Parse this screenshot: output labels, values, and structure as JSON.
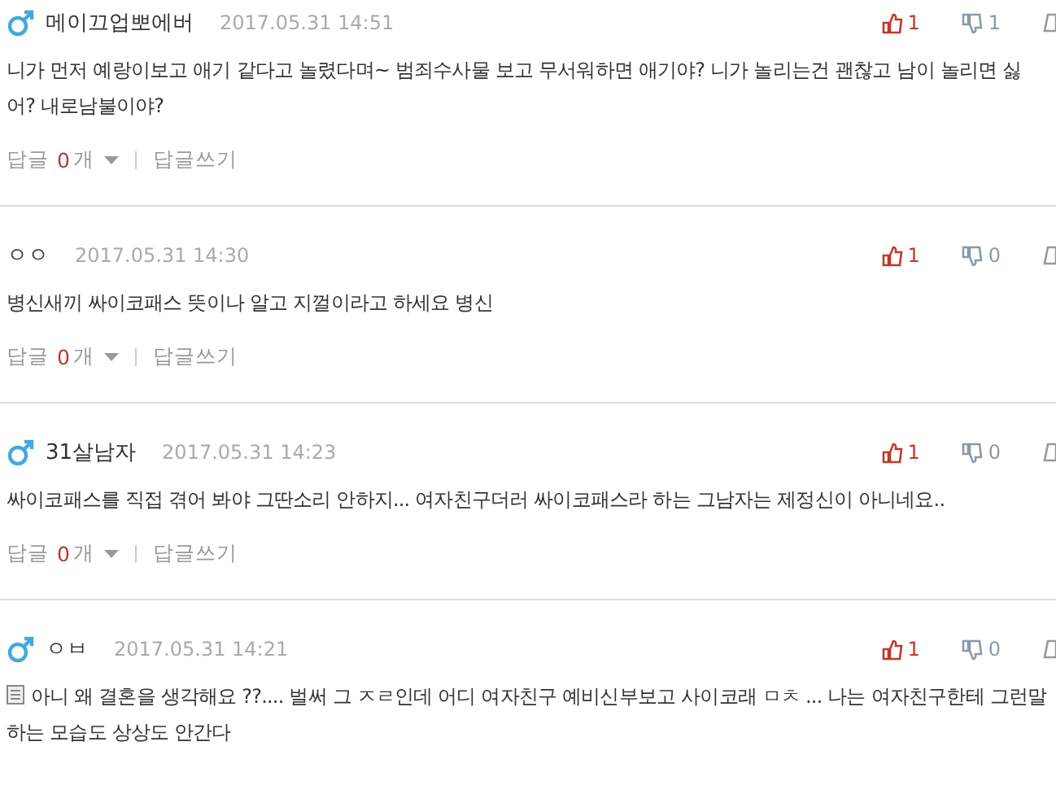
{
  "comments": [
    {
      "male": true,
      "author": "메이끄업뽀에버",
      "date": "2017.05.31 14:51",
      "likes": "1",
      "dislikes": "1",
      "memo": false,
      "text": "니가 먼저 예랑이보고 애기 같다고 놀렸다며~ 범죄수사물 보고 무서워하면 애기야? 니가 놀리는건 괜찮고 남이 놀리면 싫어? 내로남불이야?",
      "footer": {
        "reply_label": "답글",
        "reply_count": "0",
        "reply_unit": "개",
        "write": "답글쓰기"
      }
    },
    {
      "male": false,
      "author": "ㅇㅇ",
      "date": "2017.05.31 14:30",
      "likes": "1",
      "dislikes": "0",
      "memo": false,
      "text": "병신새끼 싸이코패스 뜻이나 알고 지껄이라고 하세요 병신",
      "footer": {
        "reply_label": "답글",
        "reply_count": "0",
        "reply_unit": "개",
        "write": "답글쓰기"
      }
    },
    {
      "male": true,
      "author": "31살남자",
      "date": "2017.05.31 14:23",
      "likes": "1",
      "dislikes": "0",
      "memo": false,
      "text": "싸이코패스를 직접 겪어 봐야 그딴소리 안하지... 여자친구더러 싸이코패스라 하는 그남자는 제정신이 아니네요..",
      "footer": {
        "reply_label": "답글",
        "reply_count": "0",
        "reply_unit": "개",
        "write": "답글쓰기"
      }
    },
    {
      "male": true,
      "author": "ㅇㅂ",
      "date": "2017.05.31 14:21",
      "likes": "1",
      "dislikes": "0",
      "memo": true,
      "text": "아니 왜 결혼을 생각해요 ??.... 벌써 그 ㅈㄹ인데 어디 여자친구 예비신부보고 사이코래 ㅁㅊ ... 나는 여자친구한테 그런말 하는 모습도 상상도 안간다"
    }
  ]
}
